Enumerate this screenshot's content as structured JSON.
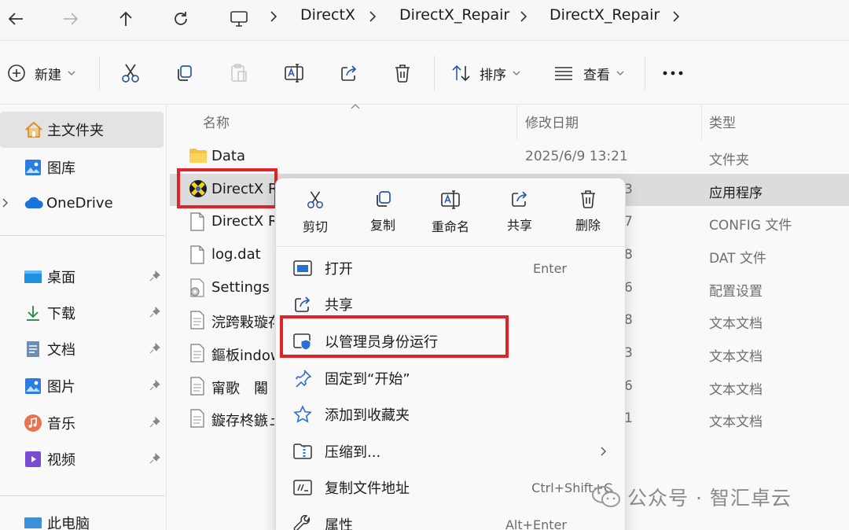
{
  "breadcrumb": [
    "DirectX",
    "DirectX_Repair",
    "DirectX_Repair"
  ],
  "toolbar": {
    "new_label": "新建",
    "sort_label": "排序",
    "view_label": "查看"
  },
  "sidebar": {
    "items": [
      "主文件夹",
      "图库",
      "OneDrive"
    ],
    "quick": [
      "桌面",
      "下载",
      "文档",
      "图片",
      "音乐",
      "视频"
    ],
    "bottom_partial": "此电脑"
  },
  "columns": {
    "name": "名称",
    "modified": "修改日期",
    "type": "类型"
  },
  "files": [
    {
      "name": "Data",
      "date": "2025/6/9 13:21",
      "type": "文件夹"
    },
    {
      "name": "DirectX R",
      "date": "3",
      "type": "应用程序"
    },
    {
      "name": "DirectX R",
      "date": "7",
      "type": "CONFIG 文件"
    },
    {
      "name": "log.dat",
      "date": "8",
      "type": "DAT 文件"
    },
    {
      "name": "Settings",
      "date": "6",
      "type": "配置设置"
    },
    {
      "name": "浣跨敤璇存",
      "date": "8",
      "type": "文本文档"
    },
    {
      "name": "鏂板indow",
      "date": "3",
      "type": "文本文档"
    },
    {
      "name": "甯歌　闂",
      "date": "6",
      "type": "文本文档"
    },
    {
      "name": "鏇存柊鏃ュ",
      "date": "1",
      "type": "文本文档"
    }
  ],
  "context_menu": {
    "quick_actions": [
      "剪切",
      "复制",
      "重命名",
      "共享",
      "删除"
    ],
    "items": [
      {
        "label": "打开",
        "shortcut": "Enter"
      },
      {
        "label": "共享",
        "shortcut": ""
      },
      {
        "label": "以管理员身份运行",
        "shortcut": ""
      },
      {
        "label": "固定到“开始”",
        "shortcut": ""
      },
      {
        "label": "添加到收藏夹",
        "shortcut": ""
      },
      {
        "label": "压缩到...",
        "shortcut": ""
      },
      {
        "label": "复制文件地址",
        "shortcut": "Ctrl+Shift+C"
      },
      {
        "label": "属性",
        "shortcut": "Alt+Enter"
      }
    ]
  },
  "watermark": "公众号 · 智汇卓云",
  "colors": {
    "highlight_box": "#e0242a",
    "selected_row": "#dcdcdc",
    "accent": "#0067c0"
  }
}
